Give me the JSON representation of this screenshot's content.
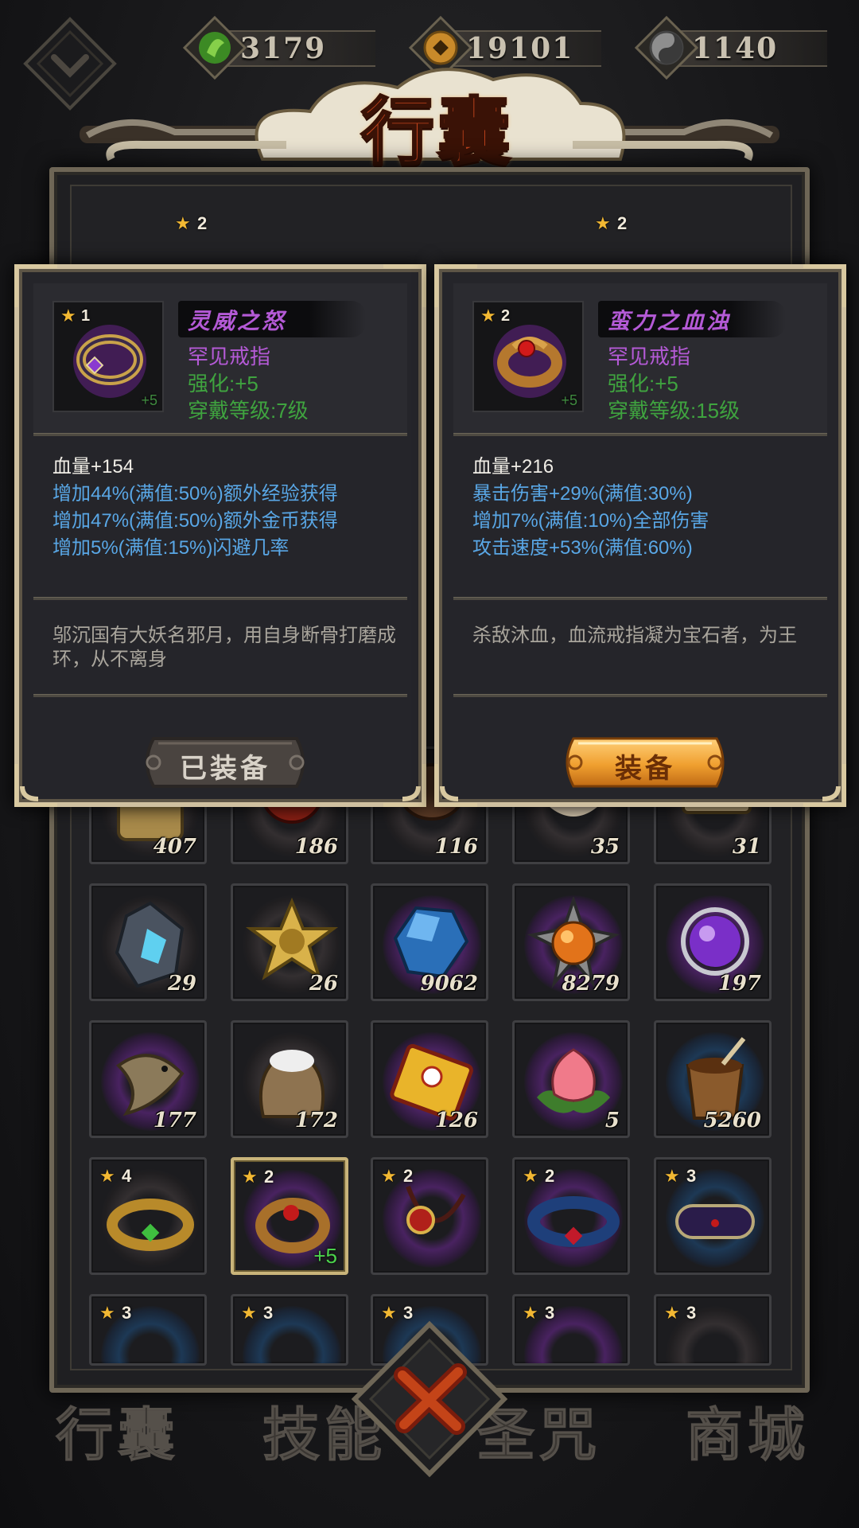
{
  "resources": [
    {
      "icon": "jade-leaf-icon",
      "value": "3179",
      "color": "#4aa32c"
    },
    {
      "icon": "gold-coin-icon",
      "value": "19101",
      "color": "#c98a2a"
    },
    {
      "icon": "silver-orb-icon",
      "value": "1140",
      "color": "#9a9a9a"
    }
  ],
  "title": "行囊",
  "equipped_header": {
    "left_star": "2",
    "right_star": "2"
  },
  "cards": [
    {
      "star": "1",
      "enhance_badge": "+5",
      "name": "灵威之怒",
      "type": "罕见戒指",
      "enhance": "强化:+5",
      "level": "穿戴等级:7级",
      "main_stat": "血量+154",
      "stats": [
        "增加44%(满值:50%)额外经验获得",
        "增加47%(满值:50%)额外金币获得",
        "增加5%(满值:15%)闪避几率"
      ],
      "description": "邬沉国有大妖名邪月，用自身断骨打磨成环，从不离身",
      "button": "已装备",
      "button_state": "disabled"
    },
    {
      "star": "2",
      "enhance_badge": "+5",
      "name": "蛮力之血浊",
      "type": "罕见戒指",
      "enhance": "强化:+5",
      "level": "穿戴等级:15级",
      "main_stat": "血量+216",
      "stats": [
        "暴击伤害+29%(满值:30%)",
        "增加7%(满值:10%)全部伤害",
        "攻击速度+53%(满值:60%)"
      ],
      "description": "杀敌沐血，血流戒指凝为宝石者，为王",
      "button": "装备",
      "button_state": "active"
    }
  ],
  "inventory_rows": [
    [
      {
        "qty": "407"
      },
      {
        "qty": "186"
      },
      {
        "qty": "116"
      },
      {
        "qty": "35"
      },
      {
        "qty": "31"
      }
    ],
    [
      {
        "qty": "29",
        "icon": "crystal-shard-icon"
      },
      {
        "qty": "26",
        "icon": "gold-star-icon"
      },
      {
        "qty": "9062",
        "icon": "blue-gem-icon"
      },
      {
        "qty": "8279",
        "icon": "fire-orb-icon"
      },
      {
        "qty": "197",
        "icon": "purple-orb-icon"
      }
    ],
    [
      {
        "qty": "177",
        "icon": "fish-icon"
      },
      {
        "qty": "172",
        "icon": "flour-sack-icon"
      },
      {
        "qty": "126",
        "icon": "talisman-scroll-icon"
      },
      {
        "qty": "5",
        "icon": "peach-icon"
      },
      {
        "qty": "5260",
        "icon": "wooden-bucket-icon"
      }
    ],
    [
      {
        "star": "4",
        "icon": "gold-ring-icon"
      },
      {
        "star": "2",
        "icon": "blood-ring-icon",
        "plus": "+5",
        "selected": true
      },
      {
        "star": "2",
        "icon": "amulet-icon"
      },
      {
        "star": "2",
        "icon": "blue-band-icon"
      },
      {
        "star": "3",
        "icon": "purple-band-icon"
      }
    ],
    [
      {
        "star": "3"
      },
      {
        "star": "3"
      },
      {
        "star": "3"
      },
      {
        "star": "3"
      },
      {
        "star": "3"
      }
    ]
  ],
  "nav": [
    "行囊",
    "技能",
    "圣咒",
    "商城"
  ]
}
